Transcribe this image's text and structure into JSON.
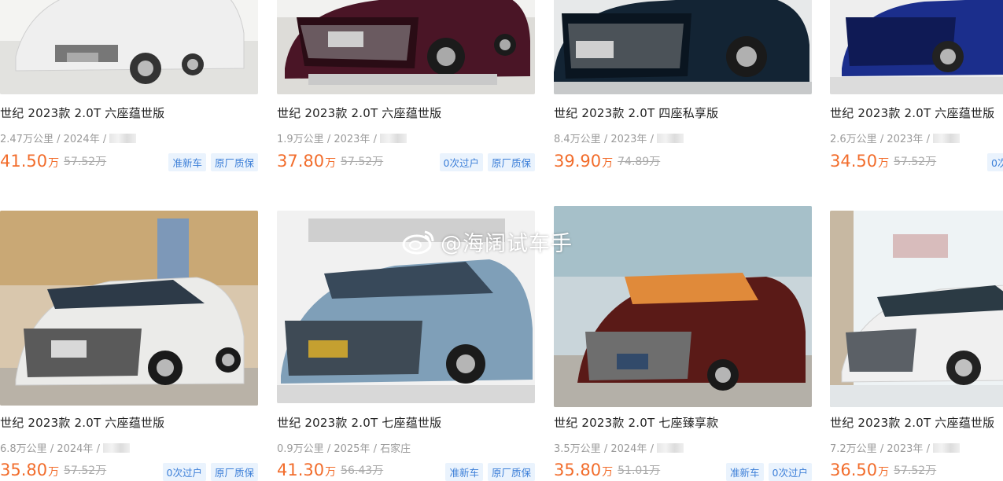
{
  "listings": [
    {
      "title": "世纪 2023款 2.0T 六座蕴世版",
      "mileage": "2.47万公里",
      "year": "2024年",
      "location": "",
      "price": "41.50",
      "unit": "万",
      "original_price": "57.52万",
      "tags": [
        "准新车",
        "原厂质保"
      ],
      "car_color": "#eeeeee"
    },
    {
      "title": "世纪 2023款 2.0T 六座蕴世版",
      "mileage": "1.9万公里",
      "year": "2023年",
      "location": "",
      "price": "37.80",
      "unit": "万",
      "original_price": "57.52万",
      "tags": [
        "0次过户",
        "原厂质保"
      ],
      "car_color": "#4a1526"
    },
    {
      "title": "世纪 2023款 2.0T 四座私享版",
      "mileage": "8.4万公里",
      "year": "2023年",
      "location": "",
      "price": "39.90",
      "unit": "万",
      "original_price": "74.89万",
      "tags": [],
      "car_color": "#132434"
    },
    {
      "title": "世纪 2023款 2.0T 六座蕴世版",
      "mileage": "2.6万公里",
      "year": "2023年",
      "location": "",
      "price": "34.50",
      "unit": "万",
      "original_price": "57.52万",
      "tags": [
        "0次"
      ],
      "car_color": "#1b2e8c"
    },
    {
      "title": "世纪 2023款 2.0T 六座蕴世版",
      "mileage": "6.8万公里",
      "year": "2024年",
      "location": "",
      "price": "35.80",
      "unit": "万",
      "original_price": "57.52万",
      "tags": [
        "0次过户",
        "原厂质保"
      ],
      "car_color": "#ebebe9"
    },
    {
      "title": "世纪 2023款 2.0T 七座蕴世版",
      "mileage": "0.9万公里",
      "year": "2025年",
      "location": "石家庄",
      "price": "41.30",
      "unit": "万",
      "original_price": "56.43万",
      "tags": [
        "准新车",
        "原厂质保"
      ],
      "car_color": "#7f9fb8"
    },
    {
      "title": "世纪 2023款 2.0T 七座臻享款",
      "mileage": "3.5万公里",
      "year": "2024年",
      "location": "",
      "price": "35.80",
      "unit": "万",
      "original_price": "51.01万",
      "tags": [
        "准新车",
        "0次过户"
      ],
      "car_color": "#5a1a17"
    },
    {
      "title": "世纪 2023款 2.0T 六座蕴世版",
      "mileage": "7.2万公里",
      "year": "2023年",
      "location": "",
      "price": "36.50",
      "unit": "万",
      "original_price": "57.52万",
      "tags": [],
      "car_color": "#f0f0f0"
    }
  ],
  "watermark": {
    "text": "@海阔试车手"
  },
  "colors": {
    "price": "#f26d2c",
    "tag_text": "#3c7fd8",
    "tag_bg": "#eaf3fd",
    "meta": "#9a9a9a"
  }
}
